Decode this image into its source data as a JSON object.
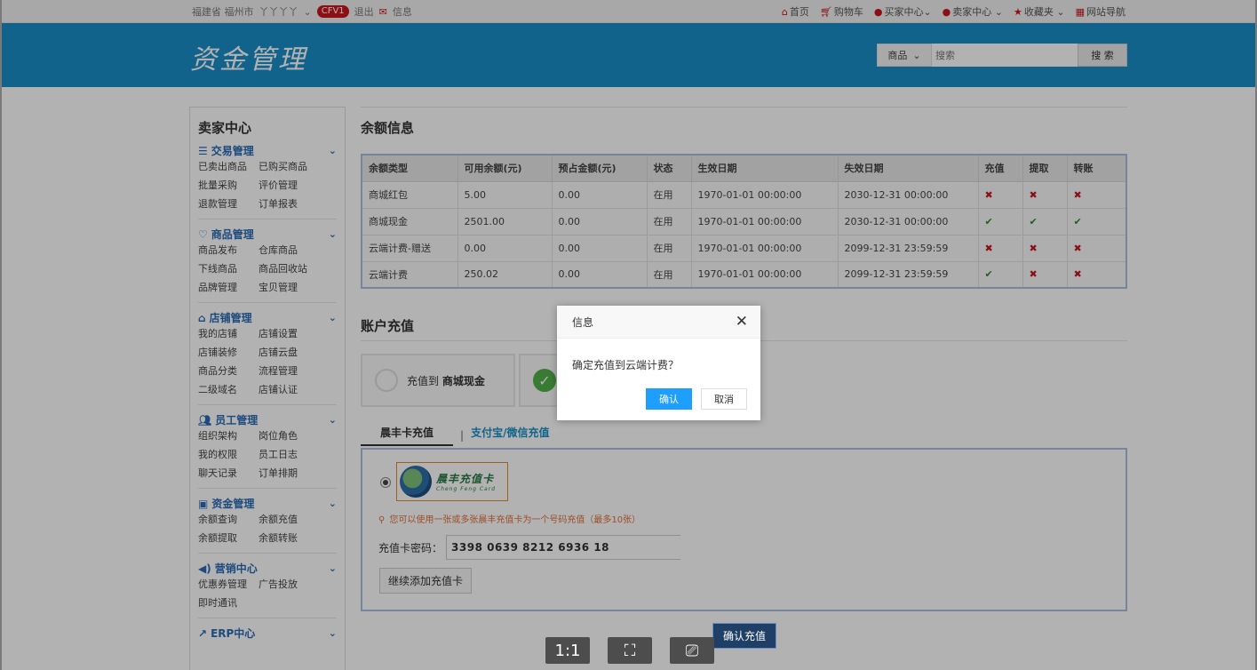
{
  "topbar": {
    "location": "福建省 福州市",
    "username": "丫丫丫丫",
    "level": "CFV1",
    "logout": "退出",
    "messages": "信息",
    "right_links": [
      {
        "label": "首页",
        "icon": "home-icon"
      },
      {
        "label": "购物车",
        "icon": "cart-icon"
      },
      {
        "label": "买家中心",
        "icon": "user-icon",
        "dropdown": true
      },
      {
        "label": "卖家中心",
        "icon": "user-icon",
        "dropdown": true
      },
      {
        "label": "收藏夹",
        "icon": "star-icon",
        "dropdown": true
      },
      {
        "label": "网站导航",
        "icon": "grid-icon"
      }
    ]
  },
  "header": {
    "logo_text": "资金管理",
    "search_category": "商品",
    "search_placeholder": "搜索",
    "search_button": "搜 索"
  },
  "sidebar": {
    "title": "卖家中心",
    "groups": [
      {
        "title": "交易管理",
        "icon": "list-icon",
        "items": [
          "已卖出商品",
          "已购买商品",
          "批量采购",
          "评价管理",
          "退款管理",
          "订单报表"
        ]
      },
      {
        "title": "商品管理",
        "icon": "heart-icon",
        "items": [
          "商品发布",
          "仓库商品",
          "下线商品",
          "商品回收站",
          "品牌管理",
          "宝贝管理"
        ]
      },
      {
        "title": "店铺管理",
        "icon": "home-icon",
        "items": [
          "我的店铺",
          "店铺设置",
          "店铺装修",
          "店铺云盘",
          "商品分类",
          "流程管理",
          "二级域名",
          "店铺认证"
        ]
      },
      {
        "title": "员工管理",
        "icon": "users-icon",
        "items": [
          "组织架构",
          "岗位角色",
          "我的权限",
          "员工日志",
          "聊天记录",
          "订单排期"
        ]
      },
      {
        "title": "资金管理",
        "icon": "money-icon",
        "items": [
          "余额查询",
          "余额充值",
          "余额提取",
          "余额转账"
        ]
      },
      {
        "title": "营销中心",
        "icon": "speaker-icon",
        "items": [
          "优惠券管理",
          "广告投放",
          "即时通讯"
        ]
      },
      {
        "title": "ERP中心",
        "icon": "chart-icon",
        "items": []
      }
    ]
  },
  "balance": {
    "title": "余额信息",
    "headers": [
      "余额类型",
      "可用余额(元)",
      "预占金额(元)",
      "状态",
      "生效日期",
      "失效日期",
      "充值",
      "提取",
      "转账"
    ],
    "rows": [
      {
        "type": "商城红包",
        "avail": "5.00",
        "reserved": "0.00",
        "status": "在用",
        "start": "1970-01-01 00:00:00",
        "end": "2030-12-31 00:00:00",
        "recharge": false,
        "withdraw": false,
        "transfer": false
      },
      {
        "type": "商城现金",
        "avail": "2501.00",
        "reserved": "0.00",
        "status": "在用",
        "start": "1970-01-01 00:00:00",
        "end": "2030-12-31 00:00:00",
        "recharge": true,
        "withdraw": true,
        "transfer": true
      },
      {
        "type": "云端计费-赠送",
        "avail": "0.00",
        "reserved": "0.00",
        "status": "在用",
        "start": "1970-01-01 00:00:00",
        "end": "2099-12-31 23:59:59",
        "recharge": false,
        "withdraw": false,
        "transfer": false
      },
      {
        "type": "云端计费",
        "avail": "250.02",
        "reserved": "0.00",
        "status": "在用",
        "start": "1970-01-01 00:00:00",
        "end": "2099-12-31 23:59:59",
        "recharge": true,
        "withdraw": false,
        "transfer": false
      }
    ]
  },
  "recharge": {
    "title": "账户充值",
    "option1_prefix": "充值到",
    "option1_target": "商城现金",
    "tab_card": "晨丰卡充值",
    "tab_pay": "支付宝/微信充值",
    "card_logo_cn": "晨丰充值卡",
    "card_logo_en": "Cheng Feng Card",
    "tip": "您可以使用一张或多张晨丰充值卡为一个号码充值（最多10张）",
    "pwd_label": "充值卡密码：",
    "pwd_value": "3398 0639 8212 6936 18",
    "add_card": "继续添加充值卡",
    "confirm": "确认充值"
  },
  "dialog": {
    "title": "信息",
    "message": "确定充值到云端计费？",
    "ok": "确认",
    "cancel": "取消"
  },
  "viewer": {
    "zoom_label": "1:1"
  },
  "colors": {
    "header_bg": "#1b8ec9",
    "accent_red": "#c8161d",
    "link_blue": "#2a6bb7",
    "dialog_ok": "#1e9fff",
    "table_border": "#a9bde3"
  }
}
